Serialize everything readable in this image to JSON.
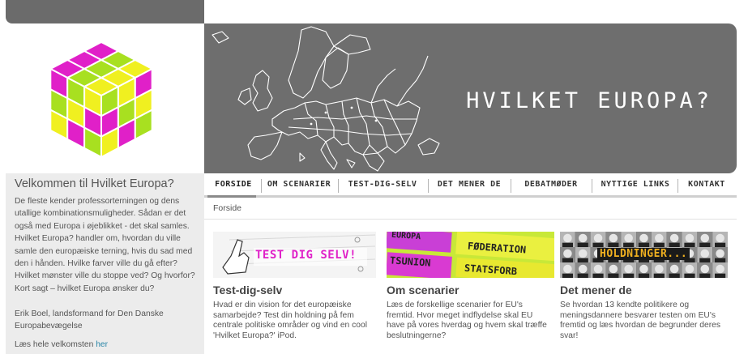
{
  "site": {
    "title": "HVILKET EUROPA?"
  },
  "sidebar": {
    "welcome_title": "Velkommen til Hvilket Europa?",
    "welcome_body": "De fleste kender professorterningen og dens utallige kombinationsmuligheder. Sådan er det også med Europa i øjeblikket - det skal samles. Hvilket Europa? handler om, hvordan du ville samle den europæiske terning, hvis du sad med den i hånden. Hvilke farver ville du gå efter? Hvilket mønster ville du stoppe ved? Og hvorfor? Kort sagt – hvilket Europa ønsker du?",
    "welcome_sign": "Erik Boel, landsformand for Den Danske Europabevægelse",
    "more_text": "Læs hele velkomsten",
    "more_link": "her"
  },
  "nav": {
    "items": [
      {
        "label": "FORSIDE"
      },
      {
        "label": "OM SCENARIER"
      },
      {
        "label": "TEST-DIG-SELV"
      },
      {
        "label": "DET MENER DE"
      },
      {
        "label": "DEBATMØDER"
      },
      {
        "label": "NYTTIGE LINKS"
      },
      {
        "label": "KONTAKT"
      }
    ]
  },
  "breadcrumb": {
    "current": "Forside"
  },
  "features": [
    {
      "title": "Test-dig-selv",
      "image_text": "TEST DIG SELV!",
      "text": "Hvad er din vision for det europæiske samarbejde? Test din holdning på fem centrale politiske områder og vind en cool 'Hvilket Europa?' iPod."
    },
    {
      "title": "Om scenarier",
      "image_words": [
        "EUROPA",
        "FØDERATION",
        "TSUNION",
        "STATSFORB"
      ],
      "text": "Læs de forskellige scenarier for EU's fremtid. Hvor meget indflydelse skal EU have på vores hverdag og hvem skal træffe beslutningerne?"
    },
    {
      "title": "Det mener de",
      "image_text": "HOLDNINGER...",
      "text": "Se hvordan 13 kendte politikere og meningsdannere besvarer testen om EU's fremtid og læs hvordan de begrunder deres svar!"
    }
  ],
  "colors": {
    "banner": "#6e6e6e",
    "sidebar_bg": "#ececec",
    "link": "#2a86a8",
    "magenta": "#e020c8",
    "lime": "#a8e020",
    "yellow": "#f0f020"
  }
}
